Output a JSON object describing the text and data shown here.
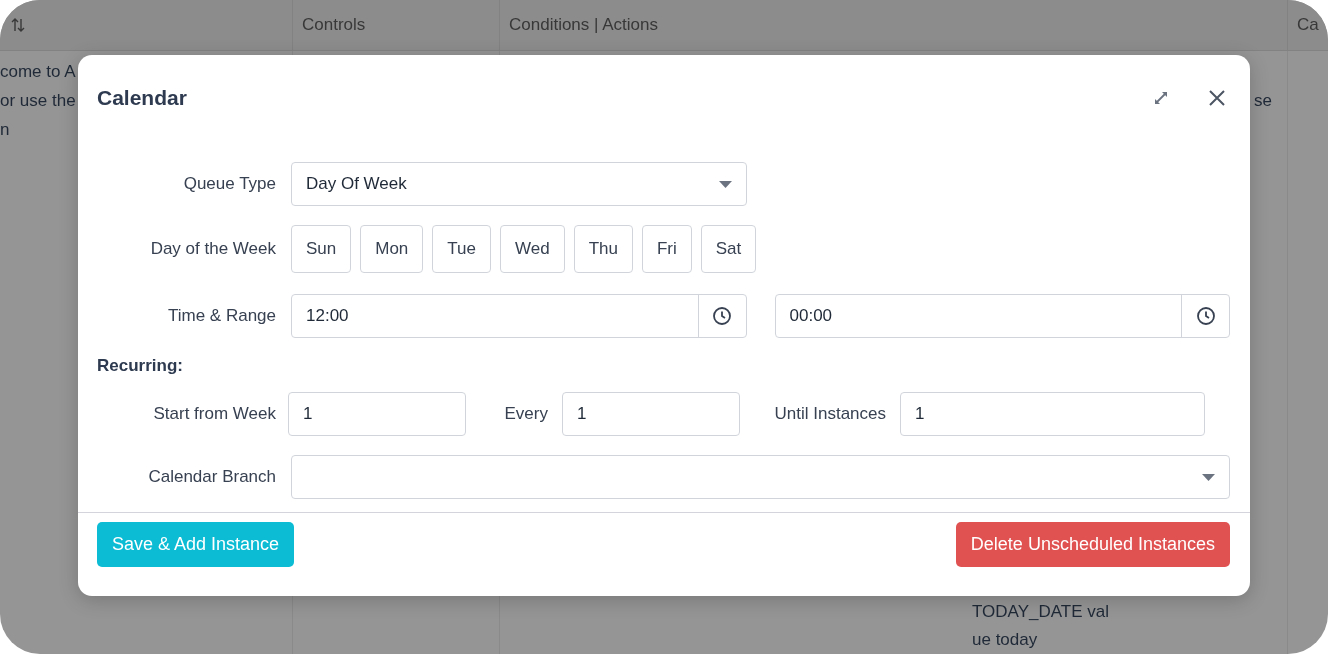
{
  "background_table": {
    "columns": [
      "",
      "Controls",
      "Conditions | Actions",
      "Ca"
    ],
    "column_1_lines": [
      "come to A",
      "or use the",
      "n"
    ],
    "column_3_top": "se",
    "column_3_bottom": [
      "TODAY_DATE val",
      "ue today"
    ]
  },
  "dialog": {
    "title": "Calendar",
    "queue_type": {
      "label": "Queue Type",
      "value": "Day Of Week"
    },
    "day_of_week": {
      "label": "Day of the Week",
      "days": [
        {
          "label": "Sun",
          "selected": false
        },
        {
          "label": "Mon",
          "selected": false
        },
        {
          "label": "Tue",
          "selected": false
        },
        {
          "label": "Wed",
          "selected": false
        },
        {
          "label": "Thu",
          "selected": false
        },
        {
          "label": "Fri",
          "selected": false
        },
        {
          "label": "Sat",
          "selected": false
        }
      ]
    },
    "time_range": {
      "label": "Time & Range",
      "start": "12:00",
      "end": "00:00"
    },
    "recurring": {
      "heading": "Recurring:",
      "start_from_week": {
        "label": "Start from Week",
        "value": "1"
      },
      "every": {
        "label": "Every",
        "value": "1"
      },
      "until_instances": {
        "label": "Until Instances",
        "value": "1"
      }
    },
    "calendar_branch": {
      "label": "Calendar Branch"
    },
    "buttons": {
      "save": "Save & Add Instance",
      "delete": "Delete Unscheduled Instances"
    }
  }
}
